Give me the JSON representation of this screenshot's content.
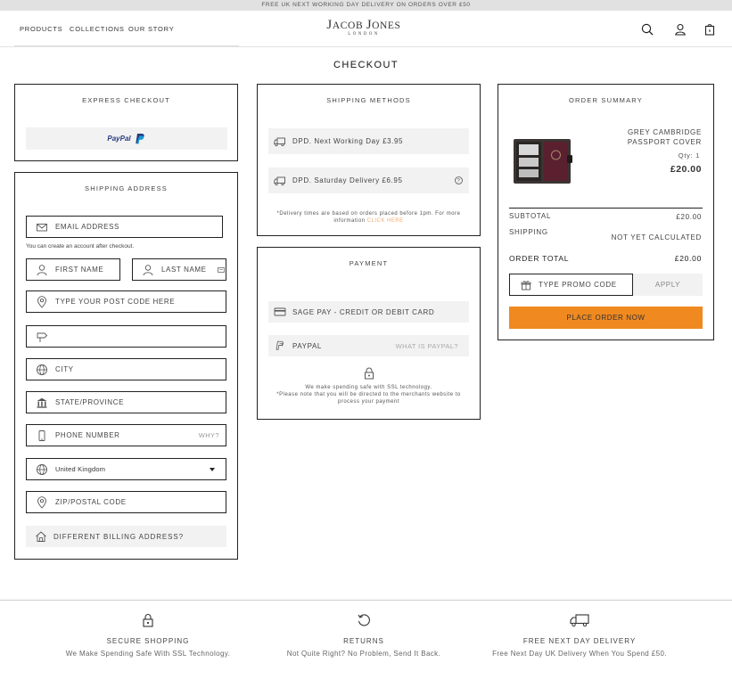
{
  "banner": "FREE UK NEXT WORKING DAY DELIVERY ON ORDERS OVER £50",
  "nav": [
    "PRODUCTS",
    "COLLECTIONS",
    "OUR STORY"
  ],
  "logo": {
    "brand_j": "J",
    "brand_acob": "ACOB ",
    "brand_j2": "J",
    "brand_ones": "ONES",
    "city": "LONDON"
  },
  "page_title": "CHECKOUT",
  "express": {
    "title": "EXPRESS CHECKOUT",
    "paypal_a": "PayPal",
    "paypal_b": ""
  },
  "shipping_address": {
    "title": "SHIPPING ADDRESS",
    "email": "EMAIL ADDRESS",
    "account_note": "You can create an account after checkout.",
    "first_name": "FIRST NAME",
    "last_name": "LAST NAME",
    "postcode_lookup": "TYPE YOUR POST CODE HERE",
    "address_line": "",
    "city": "CITY",
    "state": "STATE/PROVINCE",
    "phone": "PHONE NUMBER",
    "phone_why": "WHY?",
    "country": "United Kingdom",
    "zip": "ZIP/POSTAL CODE",
    "billing": "DIFFERENT BILLING ADDRESS?"
  },
  "shipping_methods": {
    "title": "SHIPPING METHODS",
    "options": [
      "DPD. Next Working Day £3.95",
      "DPD. Saturday Delivery £6.95"
    ],
    "note": "*Delivery times are based on orders placed before 1pm. For more information",
    "note_link": "CLICK HERE"
  },
  "payment": {
    "title": "PAYMENT",
    "sagepay": "SAGE PAY - CREDIT OR DEBIT CARD",
    "paypal": "PAYPAL",
    "what_paypal": "WHAT IS PAYPAL?",
    "ssl_note_1": "We make spending safe with SSL technology.",
    "ssl_note_2": "*Please note that you will be directed to the merchants website to process your payment"
  },
  "order_summary": {
    "title": "ORDER SUMMARY",
    "product_line1": "GREY CAMBRIDGE",
    "product_line2": "PASSPORT COVER",
    "qty": "Qty: 1",
    "price": "£20.00",
    "subtotal_label": "SUBTOTAL",
    "subtotal_value": "£20.00",
    "shipping_label": "SHIPPING",
    "shipping_value": "NOT YET CALCULATED",
    "total_label": "ORDER TOTAL",
    "total_value": "£20.00",
    "promo_placeholder": "TYPE PROMO CODE",
    "apply": "APPLY",
    "place_order": "PLACE ORDER NOW"
  },
  "footer": [
    {
      "title": "SECURE SHOPPING",
      "sub": "We Make Spending Safe With SSL Technology."
    },
    {
      "title": "RETURNS",
      "sub": "Not Quite Right? No Problem, Send It Back."
    },
    {
      "title": "FREE NEXT DAY DELIVERY",
      "sub": "Free Next Day UK Delivery When You Spend £50."
    }
  ],
  "colors": {
    "accent": "#f0891f",
    "panel_border": "#222222",
    "grey_fill": "#f2f2f2",
    "link": "#f0ab74"
  }
}
